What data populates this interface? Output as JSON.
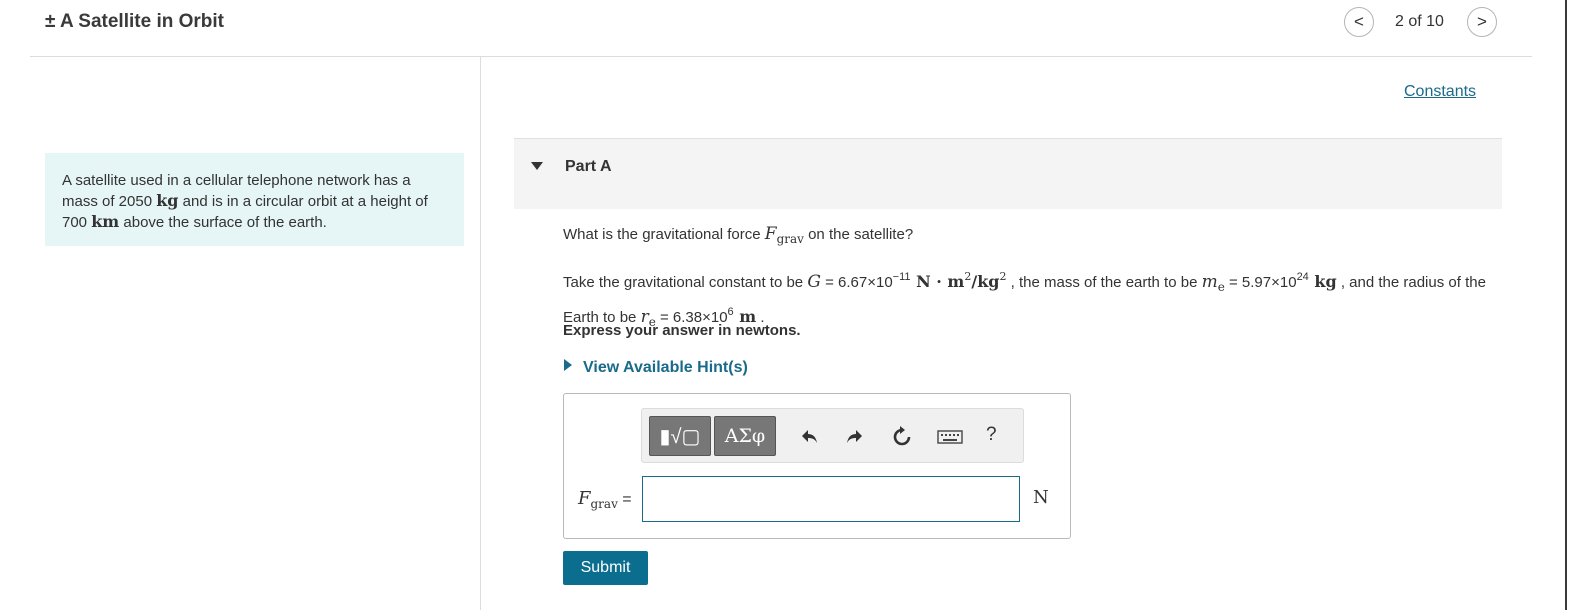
{
  "header": {
    "title": "± A Satellite in Orbit",
    "pager": "2 of 10",
    "prev_label": "<",
    "next_label": ">"
  },
  "problem": {
    "t1": "A satellite used in a cellular telephone network has a mass of 2050 ",
    "u1": "kg",
    "t2": " and is in a circular orbit at a height of 700 ",
    "u2": "km",
    "t3": " above the surface of the earth."
  },
  "constants_link": "Constants",
  "part": {
    "title": "Part A",
    "q1_a": "What is the gravitational force ",
    "q1_F": "F",
    "q1_sub": "grav",
    "q1_b": " on the satellite?",
    "q2_a": "Take the gravitational constant to be ",
    "G": "G",
    "G_eq": " = 6.67×10",
    "G_exp": "−11",
    "G_unit_a": " N · m",
    "G_unit_exp1": "2",
    "G_unit_b": "/kg",
    "G_unit_exp2": "2",
    "q2_b": " , the mass of the earth to be ",
    "m": "m",
    "m_sub": "e",
    "m_eq": " = 5.97×10",
    "m_exp": "24",
    "m_unit": " kg",
    "q2_c": " , and the radius of the Earth to be ",
    "r": "r",
    "r_sub": "e",
    "r_eq": " = 6.38×10",
    "r_exp": "6",
    "r_unit": " m",
    "q2_d": " .",
    "express": "Express your answer in newtons.",
    "hint": "View Available Hint(s)"
  },
  "toolbar": {
    "template_label": "▮√▢",
    "greek_label": "ΑΣφ",
    "help_label": "?",
    "icons": [
      "undo-icon",
      "redo-icon",
      "reset-icon",
      "keyboard-icon"
    ]
  },
  "answer": {
    "label_F": "F",
    "label_sub": "grav",
    "label_eq": " =",
    "value": "",
    "unit": "N"
  },
  "submit_label": "Submit"
}
